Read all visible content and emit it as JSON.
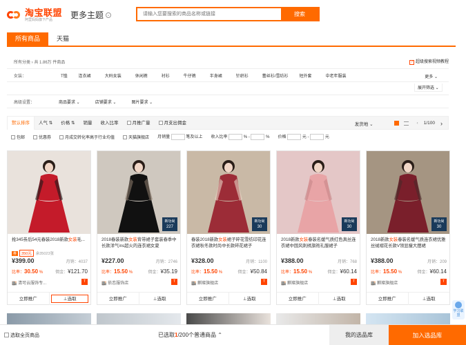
{
  "header": {
    "logo_text": "淘宝联盟",
    "logo_sub": "阿里妈妈旗下产品",
    "theme_title": "更多主题",
    "search_placeholder": "请输入您要搜索的商品名称或链接",
    "search_button": "搜索"
  },
  "tabs": [
    {
      "label": "所有商品",
      "active": true
    },
    {
      "label": "天猫",
      "active": false
    }
  ],
  "breadcrumb": "所有分类 › 共 1.86万 件商品",
  "help_link": "超级搜索视频教程",
  "category": {
    "label": "女装：",
    "items": [
      "T恤",
      "连衣裙",
      "大码女装",
      "休闲裤",
      "衬衫",
      "牛仔裤",
      "半身裙",
      "针织衫",
      "蕾丝衫/雪纺衫",
      "短外套",
      "中老年服装"
    ],
    "more": "更多",
    "expand": "展开筛选"
  },
  "advanced": {
    "label": "高级设置：",
    "dropdowns": [
      "商品要求",
      "店铺要求",
      "图片要求"
    ]
  },
  "sort": {
    "items": [
      "默认排序",
      "人气",
      "价格",
      "销量",
      "收入比率",
      "月推广量",
      "月支出佣金"
    ],
    "ship": "发货地",
    "page": "1/100"
  },
  "filters": {
    "checks": [
      "包邮",
      "优惠券",
      "月成交转化率高于行业均值",
      "天猫旗舰店"
    ],
    "monthly": "月销量",
    "monthly_unit": "笔及以上",
    "ratio": "收入比率",
    "pct": "%",
    "price": "价格",
    "yuan": "元"
  },
  "products": [
    {
      "title_pre": "抢345劵后54元春装2018新款",
      "title_hl": "女装",
      "title_post": "毛...",
      "coupon": "350元",
      "coupon_remain": "余35023张",
      "price": "¥399.00",
      "sales": "月销：4037",
      "rate": "30.50",
      "earn": "¥121.70",
      "shop": "清可云服饰专...",
      "badge": false,
      "colors": [
        "#e9e2dc",
        "#c41b2a",
        "#1a1a1a"
      ]
    },
    {
      "title_pre": "2018春装新款",
      "title_hl": "女装",
      "title_post": "背带裙子套装春季中长款洋气ins超火的连衣裙女夏",
      "coupon": "",
      "coupon_remain": "",
      "price": "¥227.00",
      "sales": "月销：2746",
      "rate": "15.50",
      "earn": "¥35.19",
      "shop": "依恋服饰店",
      "badge": true,
      "badge_top": "新功尚",
      "badge_price": "227",
      "colors": [
        "#cfc8bf",
        "#111111",
        "#8a7a6a"
      ]
    },
    {
      "title_pre": "春装2018新款",
      "title_hl": "女装",
      "title_post": "裙子碎花雪纺印花连衣裙秋冬款时尚中长款碎花裙子",
      "coupon": "",
      "coupon_remain": "",
      "price": "¥328.00",
      "sales": "月销：1100",
      "rate": "15.50",
      "earn": "¥50.84",
      "shop": "麒璨旗舰店",
      "badge": true,
      "badge_top": "新功尚",
      "badge_price": "30",
      "colors": [
        "#c9b9a6",
        "#9c2c37",
        "#e9d7c6"
      ]
    },
    {
      "title_pre": "2018新款",
      "title_hl": "女装",
      "title_post": "春装名媛气质红色真丝连衣裙中国风刺绣旗袍礼服裙子",
      "coupon": "",
      "coupon_remain": "",
      "price": "¥388.00",
      "sales": "月销：768",
      "rate": "15.50",
      "earn": "¥60.14",
      "shop": "麒璨旗舰店",
      "badge": true,
      "badge_top": "新功尚",
      "badge_price": "30",
      "colors": [
        "#e4c7c7",
        "#e8a4a6",
        "#c78789"
      ]
    },
    {
      "title_pre": "2018新款",
      "title_hl": "女装",
      "title_post": "春装名媛气质连衣裙优雅丝绒褶花长款V领显瘦大摆裙",
      "coupon": "",
      "coupon_remain": "",
      "price": "¥388.00",
      "sales": "月销：209",
      "rate": "15.50",
      "earn": "¥60.14",
      "shop": "麒璨旗舰店",
      "badge": true,
      "badge_top": "新功尚",
      "badge_price": "30",
      "colors": [
        "#a59582",
        "#7a1f2b",
        "#4a2a2a"
      ]
    }
  ],
  "card_actions": {
    "promote": "立即推广",
    "select": "选取"
  },
  "rate_label": "比率：",
  "earn_label": "佣金：",
  "bottom": {
    "select_all": "选取全页商品",
    "selected_prefix": "已选取",
    "selected_count": "1",
    "selected_suffix": "/200个普通商品",
    "library": "我的选品库",
    "add": "加入选品库"
  },
  "learn": "学习联盟"
}
